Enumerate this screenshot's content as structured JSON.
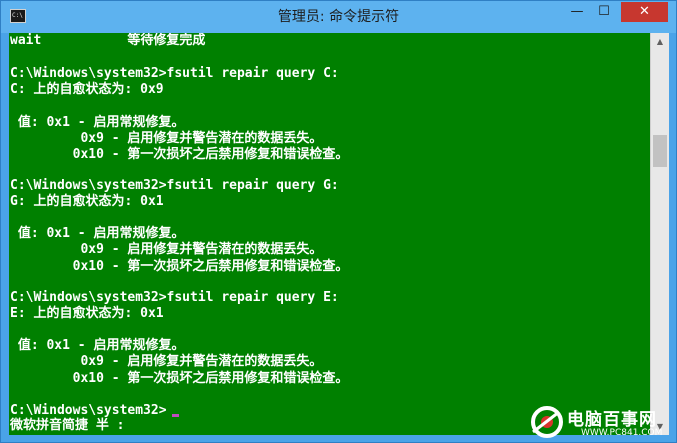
{
  "window": {
    "title": "管理员: 命令提示符",
    "icon_text": "C:\\",
    "minimize_glyph": "—",
    "maximize_glyph": "☐",
    "close_glyph": "✕"
  },
  "console": {
    "background_color": "#008000",
    "text_color": "#ffffff",
    "lines": [
      "wait           等待修复完成",
      "",
      "C:\\Windows\\system32>fsutil repair query C:",
      "C: 上的自愈状态为: 0x9",
      "",
      " 值: 0x1 - 启用常规修复。",
      "         0x9 - 启用修复并警告潜在的数据丢失。",
      "        0x10 - 第一次损坏之后禁用修复和错误检查。",
      "",
      "C:\\Windows\\system32>fsutil repair query G:",
      "G: 上的自愈状态为: 0x1",
      "",
      " 值: 0x1 - 启用常规修复。",
      "         0x9 - 启用修复并警告潜在的数据丢失。",
      "        0x10 - 第一次损坏之后禁用修复和错误检查。",
      "",
      "C:\\Windows\\system32>fsutil repair query E:",
      "E: 上的自愈状态为: 0x1",
      "",
      " 值: 0x1 - 启用常规修复。",
      "         0x9 - 启用修复并警告潜在的数据丢失。",
      "        0x10 - 第一次损坏之后禁用修复和错误检查。",
      "",
      "C:\\Windows\\system32>",
      "微软拼音简捷 半 :"
    ]
  },
  "scrollbar": {
    "up_glyph": "▲",
    "down_glyph": "▼"
  },
  "watermark": {
    "text": "电脑百事网",
    "subtext": "WWW.PC841.COM"
  }
}
